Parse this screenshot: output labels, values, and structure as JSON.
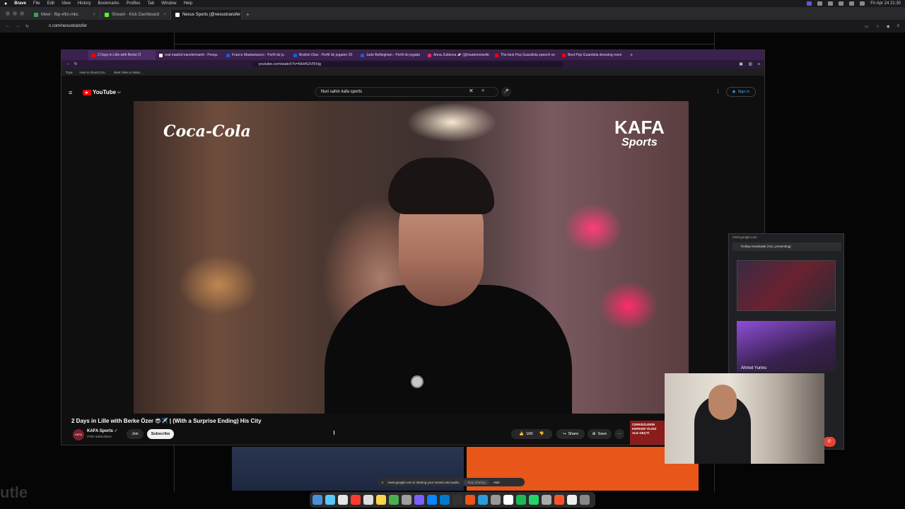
{
  "menubar": {
    "app": "Brave",
    "items": [
      "File",
      "Edit",
      "View",
      "History",
      "Bookmarks",
      "Profiles",
      "Tab",
      "Window",
      "Help"
    ],
    "clock": "Fri Apr 24  21:30"
  },
  "outer_tabs": [
    {
      "label": "Meet - fbp-vfkn-mkc",
      "color": "#34a853"
    },
    {
      "label": "Stream · Kick Dashboard",
      "color": "#53fc18"
    },
    {
      "label": "Nexus Sports (@nexustransfer",
      "color": "#ffffff"
    }
  ],
  "outer_address": {
    "url": "x.com/nexustransfer"
  },
  "inner_tabs": [
    {
      "label": "2 Days in Lille with Berke Ö",
      "color": "#ff0000"
    },
    {
      "label": "real madrid transfermarkt - Pesqu",
      "color": "#ffffff"
    },
    {
      "label": "Franco Mastantuono - Perfil de ju",
      "color": "#1d5ecb"
    },
    {
      "label": "Brahim Díaz - Perfil do jogador 20",
      "color": "#1d5ecb"
    },
    {
      "label": "Jude Bellingham - Perfil do jogado",
      "color": "#1d5ecb"
    },
    {
      "label": "Anna Zubkova 🪐 (@mademoiselle",
      "color": "#e1306c"
    },
    {
      "label": "The best Pep Guardiola speech ev",
      "color": "#ff0000"
    },
    {
      "label": "Best Pep Guardiola dressing room",
      "color": "#ff0000"
    }
  ],
  "inner_address": {
    "url": "youtube.com/watch?v=NHrNJVIFHg"
  },
  "inner_bookmarks": [
    "Toya",
    "How to shoot CIN...",
    "Best Sites to Watc..."
  ],
  "youtube": {
    "logo": "YouTube",
    "logo_region": "AT",
    "search_value": "Nuri sahin kafa sports",
    "sign_in": "Sign in",
    "video_brand_left": "Coca-Cola",
    "video_brand_right": "KAFA",
    "video_brand_right_sub": "Sports",
    "video_title": "2 Days in Lille with Berke Özer 😎✈️ | (With a Surprise Ending) His City",
    "channel_name": "KAFA Sports",
    "channel_avatar": "KAFA",
    "channel_subs": "375K subscribers",
    "join": "Join",
    "subscribe": "Subscribe",
    "likes": "16K",
    "share": "Share",
    "save": "Save",
    "ad_thumb_text": "CERKEZLERIN KERKER YILDIZ ALE GEÇTİ"
  },
  "meet": {
    "url": "meet.google.com",
    "user": "Rolkay Karabulak (You, presenting)",
    "participant_name": "Ahmet Yumru"
  },
  "sharebar": {
    "text": "meet.google.com is sharing your screen and audio.",
    "stop": "Stop sharing",
    "hide": "Hide"
  }
}
